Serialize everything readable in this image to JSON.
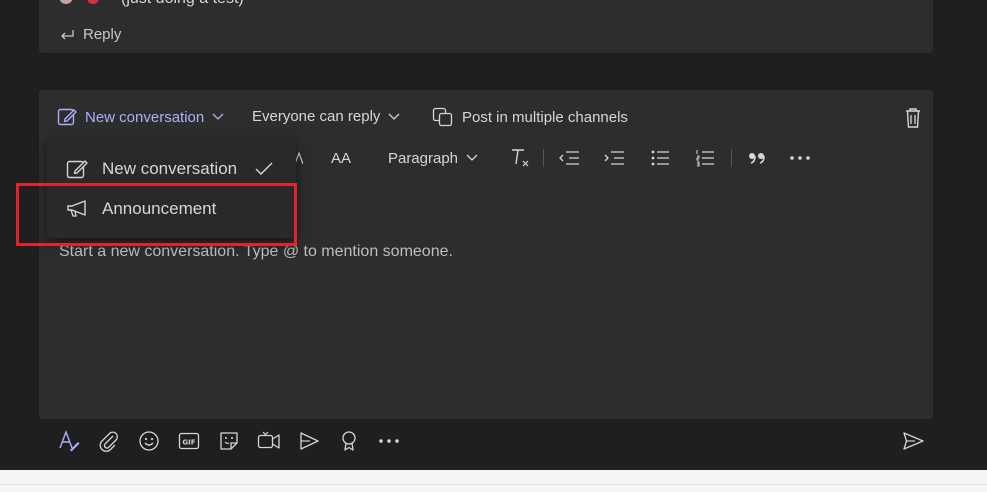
{
  "colors": {
    "accent": "#aab1fa",
    "highlight": "#e0232f",
    "background": "#1f1f1f",
    "card": "#2d2d2d"
  },
  "previous_message": {
    "text": "(just doing a test)",
    "reply_label": "Reply"
  },
  "compose": {
    "toolbar": {
      "new_conversation_label": "New conversation",
      "everyone_label": "Everyone can reply",
      "multi_channel_label": "Post in multiple channels"
    },
    "format": {
      "paragraph_label": "Paragraph",
      "font_size_label": "AA",
      "icons": [
        "clear-formatting-icon",
        "decrease-indent-icon",
        "increase-indent-icon",
        "bulleted-list-icon",
        "numbered-list-icon",
        "quote-icon",
        "more-options-icon"
      ]
    },
    "placeholder": "Start a new conversation. Type @ to mention someone."
  },
  "dropdown": {
    "items": [
      {
        "label": "New conversation",
        "icon": "edit-icon",
        "selected": true
      },
      {
        "label": "Announcement",
        "icon": "megaphone-icon",
        "selected": false
      }
    ]
  },
  "bottom_bar": {
    "icons": [
      "format-icon",
      "attach-icon",
      "emoji-icon",
      "gif-icon",
      "sticker-icon",
      "meet-now-icon",
      "stream-icon",
      "praise-icon",
      "more-options-icon"
    ],
    "send_icon": "send-icon"
  }
}
